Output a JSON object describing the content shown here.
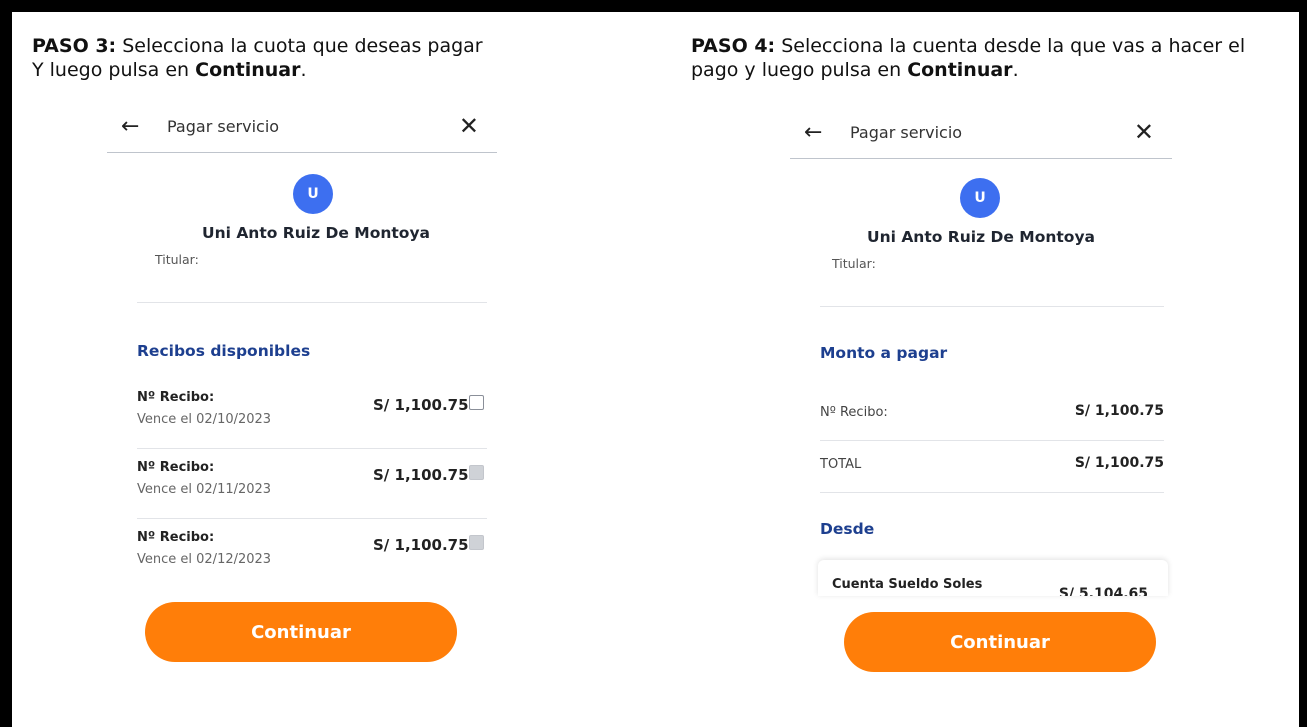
{
  "step3": {
    "heading_bold": "PASO 3:",
    "heading_rest": " Selecciona la cuota que deseas pagar",
    "heading_line2_pre": "Y luego pulsa en ",
    "heading_line2_bold": "Continuar",
    "heading_line2_end": ".",
    "topbar": {
      "back_icon": "←",
      "title": "Pagar servicio",
      "close_icon": "✕"
    },
    "avatar_letter": "U",
    "service_name": "Uni Anto Ruiz De Montoya",
    "holder_label": "Titular:",
    "section_title": "Recibos disponibles",
    "receipts": [
      {
        "label": "Nº Recibo:",
        "due": "Vence el 02/10/2023",
        "amount": "S/ 1,100.75",
        "checkbox": "empty"
      },
      {
        "label": "Nº Recibo:",
        "due": "Vence el 02/11/2023",
        "amount": "S/ 1,100.75",
        "checkbox": "disabled"
      },
      {
        "label": "Nº Recibo:",
        "due": "Vence el 02/12/2023",
        "amount": "S/ 1,100.75",
        "checkbox": "disabled"
      }
    ],
    "button_label": "Continuar"
  },
  "step4": {
    "heading_bold": "PASO 4:",
    "heading_rest": " Selecciona la cuenta desde la que vas a hacer el",
    "heading_line2_pre": "pago y luego pulsa en ",
    "heading_line2_bold": "Continuar",
    "heading_line2_end": ".",
    "topbar": {
      "back_icon": "←",
      "title": "Pagar servicio",
      "close_icon": "✕"
    },
    "avatar_letter": "U",
    "service_name": "Uni Anto Ruiz De Montoya",
    "holder_label": "Titular:",
    "amount_section_title": "Monto a pagar",
    "receipt_row": {
      "label": "Nº Recibo:",
      "value": "S/ 1,100.75"
    },
    "total_row": {
      "label": "TOTAL",
      "value": "S/ 1,100.75"
    },
    "from_section_title": "Desde",
    "account": {
      "name": "Cuenta Sueldo Soles",
      "balance": "S/ 5,104.65"
    },
    "button_label": "Continuar"
  },
  "colors": {
    "accent_orange": "#ff7e09",
    "avatar_blue": "#3d6ff0",
    "section_blue": "#1d3f8f"
  }
}
